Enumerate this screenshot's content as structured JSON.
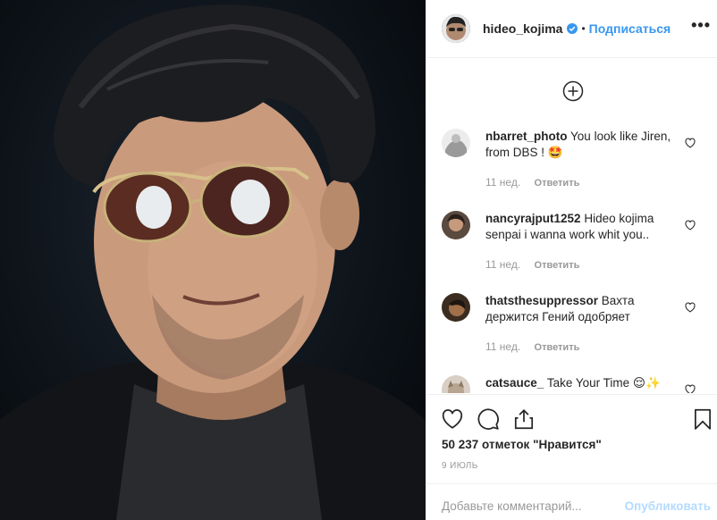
{
  "post": {
    "author": {
      "username": "hideo_kojima",
      "verified": true,
      "follow_label": "Подписаться",
      "separator": "•"
    },
    "more_options": "•••",
    "likes_text": "50 237 отметок \"Нравится\"",
    "date": "9 ИЮЛЬ"
  },
  "comments": [
    {
      "username": "nbarret_photo",
      "text": "You look like Jiren, from DBS ! 🤩",
      "age": "11 нед.",
      "reply_label": "Ответить"
    },
    {
      "username": "nancyrajput1252",
      "text": "Hideo kojima senpai i wanna work whit you..",
      "age": "11 нед.",
      "reply_label": "Ответить"
    },
    {
      "username": "thatsthesuppressor",
      "text": "Вахта держится Гений одобряет",
      "age": "11 нед.",
      "reply_label": "Ответить"
    },
    {
      "username": "catsauce_",
      "text": "Take Your Time 😌✨",
      "age": "",
      "reply_label": ""
    }
  ],
  "comment_box": {
    "placeholder": "Добавьте комментарий...",
    "publish_label": "Опубликовать"
  },
  "icons": {
    "load_more": "plus-circle-icon",
    "like": "heart-icon",
    "comment": "comment-bubble-icon",
    "share": "share-icon",
    "save": "bookmark-icon",
    "verified": "verified-badge-icon",
    "comment_like": "small-heart-icon"
  },
  "colors": {
    "link": "#3897f0",
    "muted": "#999999",
    "text": "#262626",
    "border": "#efefef",
    "publish_disabled": "#b3dbff"
  }
}
